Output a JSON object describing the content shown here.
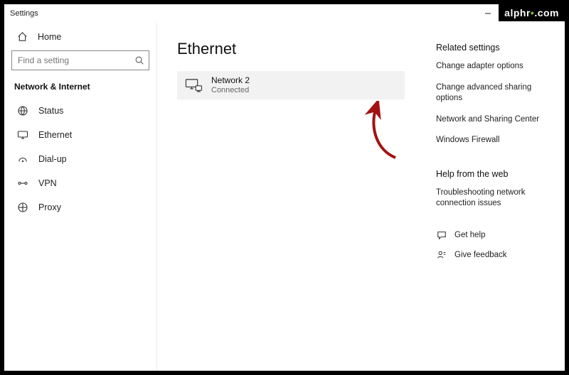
{
  "window": {
    "title": "Settings"
  },
  "sidebar": {
    "home_label": "Home",
    "search_placeholder": "Find a setting",
    "section_title": "Network & Internet",
    "items": [
      {
        "label": "Status"
      },
      {
        "label": "Ethernet"
      },
      {
        "label": "Dial-up"
      },
      {
        "label": "VPN"
      },
      {
        "label": "Proxy"
      }
    ]
  },
  "main": {
    "heading": "Ethernet",
    "connection": {
      "name": "Network 2",
      "status": "Connected"
    }
  },
  "right": {
    "related_heading": "Related settings",
    "links": [
      "Change adapter options",
      "Change advanced sharing options",
      "Network and Sharing Center",
      "Windows Firewall"
    ],
    "help_heading": "Help from the web",
    "help_links": [
      "Troubleshooting network connection issues"
    ],
    "actions": [
      {
        "label": "Get help"
      },
      {
        "label": "Give feedback"
      }
    ]
  },
  "watermark": {
    "text": "alphr",
    "suffix": ".com"
  },
  "annotation": {
    "arrow_color": "#a31212"
  }
}
